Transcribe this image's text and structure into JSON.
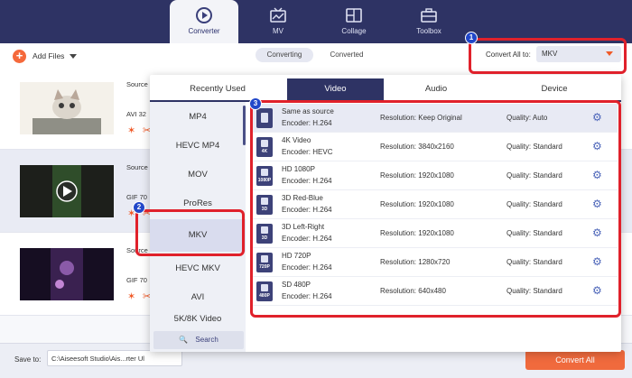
{
  "nav": {
    "tabs": [
      {
        "label": "Converter",
        "icon": "converter-icon"
      },
      {
        "label": "MV",
        "icon": "mv-icon"
      },
      {
        "label": "Collage",
        "icon": "collage-icon"
      },
      {
        "label": "Toolbox",
        "icon": "toolbox-icon"
      }
    ]
  },
  "toolbar": {
    "add_files": "Add Files",
    "seg_converting": "Converting",
    "seg_converted": "Converted",
    "convert_all_label": "Convert All to:",
    "convert_all_value": "MKV"
  },
  "files": [
    {
      "source": "Source",
      "meta": "AVI  32"
    },
    {
      "source": "Source",
      "meta": "GIF  70"
    },
    {
      "source": "Source",
      "meta": "GIF  70"
    }
  ],
  "bottom": {
    "save_to": "Save to:",
    "path": "C:\\Aiseesoft Studio\\Ais...rter Ul",
    "convert_all_btn": "Convert All"
  },
  "panel": {
    "tabs": [
      "Recently Used",
      "Video",
      "Audio",
      "Device"
    ],
    "active_tab": "Video",
    "formats": [
      "MP4",
      "HEVC MP4",
      "MOV",
      "ProRes",
      "MKV",
      "HEVC MKV",
      "AVI",
      "5K/8K Video"
    ],
    "selected_format": "MKV",
    "search_label": "Search",
    "presets": [
      {
        "name": "Same as source",
        "encoder": "Encoder: H.264",
        "resolution": "Resolution: Keep Original",
        "quality": "Quality: Auto",
        "tag": ""
      },
      {
        "name": "4K Video",
        "encoder": "Encoder: HEVC",
        "resolution": "Resolution: 3840x2160",
        "quality": "Quality: Standard",
        "tag": "4K"
      },
      {
        "name": "HD 1080P",
        "encoder": "Encoder: H.264",
        "resolution": "Resolution: 1920x1080",
        "quality": "Quality: Standard",
        "tag": "1080P"
      },
      {
        "name": "3D Red-Blue",
        "encoder": "Encoder: H.264",
        "resolution": "Resolution: 1920x1080",
        "quality": "Quality: Standard",
        "tag": "3D"
      },
      {
        "name": "3D Left-Right",
        "encoder": "Encoder: H.264",
        "resolution": "Resolution: 1920x1080",
        "quality": "Quality: Standard",
        "tag": "3D"
      },
      {
        "name": "HD 720P",
        "encoder": "Encoder: H.264",
        "resolution": "Resolution: 1280x720",
        "quality": "Quality: Standard",
        "tag": "720P"
      },
      {
        "name": "SD 480P",
        "encoder": "Encoder: H.264",
        "resolution": "Resolution: 640x480",
        "quality": "Quality: Standard",
        "tag": "480P"
      }
    ]
  },
  "annotations": {
    "badge_1": "1",
    "badge_2": "2",
    "badge_3": "3"
  },
  "colors": {
    "accent": "#f05a28",
    "nav_bg": "#2e3364",
    "highlight": "#e0212b",
    "badge": "#2147c9"
  }
}
